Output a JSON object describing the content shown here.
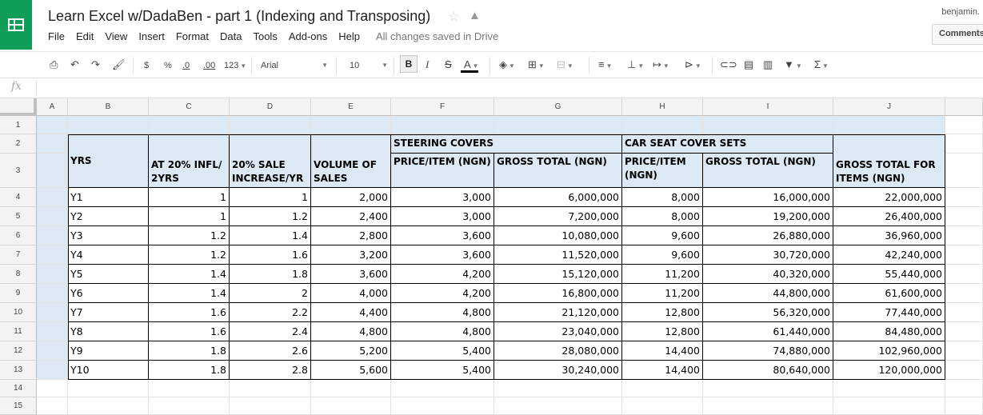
{
  "app": {
    "title": "Learn Excel w/DadaBen - part 1 (Indexing and Transposing)",
    "user": "benjamin.",
    "comments_label": "Comments",
    "save_status": "All changes saved in Drive",
    "brand_color": "#0f9d58"
  },
  "menu": [
    "File",
    "Edit",
    "View",
    "Insert",
    "Format",
    "Data",
    "Tools",
    "Add-ons",
    "Help"
  ],
  "toolbar": {
    "currency": "$",
    "percent": "%",
    "decrease_decimal": ".0",
    "increase_decimal": ".00",
    "more_formats": "123",
    "font": "Arial",
    "font_size": "10",
    "bold": "B",
    "italic": "I",
    "strike": "S",
    "text_color": "A",
    "sum": "Σ"
  },
  "formula_bar": {
    "fx": "fx",
    "value": ""
  },
  "columns": [
    "A",
    "B",
    "C",
    "D",
    "E",
    "F",
    "G",
    "H",
    "I",
    "J"
  ],
  "rows": [
    "1",
    "2",
    "3",
    "4",
    "5",
    "6",
    "7",
    "8",
    "9",
    "10",
    "11",
    "12",
    "13",
    "14",
    "15"
  ],
  "sheet": {
    "group_steering": "STEERING COVERS",
    "group_car_seat": "CAR SEAT COVER SETS",
    "headers": {
      "yrs": "YRS",
      "infl": "AT 20% INFL/ 2YRS",
      "sale": "20% SALE INCREASE/YR",
      "volume": "VOLUME OF SALES",
      "steer_price": "PRICE/ITEM (NGN)",
      "steer_gross": "GROSS TOTAL (NGN)",
      "seat_price": "PRICE/ITEM (NGN)",
      "seat_gross": "GROSS TOTAL (NGN)",
      "gross_all": "GROSS TOTAL FOR ITEMS (NGN)"
    },
    "data": [
      [
        "Y1",
        "1",
        "1",
        "2,000",
        "3,000",
        "6,000,000",
        "8,000",
        "16,000,000",
        "22,000,000"
      ],
      [
        "Y2",
        "1",
        "1.2",
        "2,400",
        "3,000",
        "7,200,000",
        "8,000",
        "19,200,000",
        "26,400,000"
      ],
      [
        "Y3",
        "1.2",
        "1.4",
        "2,800",
        "3,600",
        "10,080,000",
        "9,600",
        "26,880,000",
        "36,960,000"
      ],
      [
        "Y4",
        "1.2",
        "1.6",
        "3,200",
        "3,600",
        "11,520,000",
        "9,600",
        "30,720,000",
        "42,240,000"
      ],
      [
        "Y5",
        "1.4",
        "1.8",
        "3,600",
        "4,200",
        "15,120,000",
        "11,200",
        "40,320,000",
        "55,440,000"
      ],
      [
        "Y6",
        "1.4",
        "2",
        "4,000",
        "4,200",
        "16,800,000",
        "11,200",
        "44,800,000",
        "61,600,000"
      ],
      [
        "Y7",
        "1.6",
        "2.2",
        "4,400",
        "4,800",
        "21,120,000",
        "12,800",
        "56,320,000",
        "77,440,000"
      ],
      [
        "Y8",
        "1.6",
        "2.4",
        "4,800",
        "4,800",
        "23,040,000",
        "12,800",
        "61,440,000",
        "84,480,000"
      ],
      [
        "Y9",
        "1.8",
        "2.6",
        "5,200",
        "5,400",
        "28,080,000",
        "14,400",
        "74,880,000",
        "102,960,000"
      ],
      [
        "Y10",
        "1.8",
        "2.8",
        "5,600",
        "5,400",
        "30,240,000",
        "14,400",
        "80,640,000",
        "120,000,000"
      ]
    ],
    "header_fill": "#dce9f5"
  }
}
